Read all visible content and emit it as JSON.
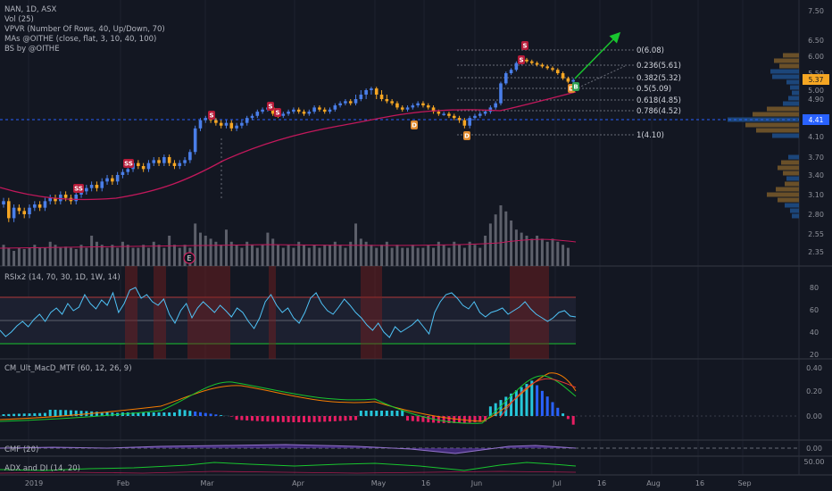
{
  "legend": {
    "title": "NAN, 1D, ASX",
    "vol": "Vol (25)",
    "vpvr": "VPVR (Number Of Rows, 40, Up/Down, 70)",
    "mas": "MAs @OITHE (close, flat, 3, 10, 40, 100)",
    "bs": "BS by @OITHE"
  },
  "panes": {
    "rsi": "RSIx2 (14, 70, 30, 1D, 1W, 14)",
    "macd": "CM_Ult_MacD_MTF (60, 12, 26, 9)",
    "cmf": "CMF (20)",
    "adx": "ADX and DI (14, 20)"
  },
  "price_axis": [
    "7.50",
    "6.50",
    "6.00",
    "5.50",
    "5.00",
    "4.90",
    "4.41",
    "4.10",
    "3.70",
    "3.40",
    "3.10",
    "2.80",
    "2.55",
    "2.35"
  ],
  "current_price": "5.37",
  "crosshair_price": "4.41",
  "rsi_axis": [
    "80",
    "60",
    "40",
    "20"
  ],
  "macd_axis": [
    "0.40",
    "0.20",
    "0.00"
  ],
  "cmf_axis": [
    "0.00"
  ],
  "adx_axis": [
    "50.00"
  ],
  "time_axis": [
    "2019",
    "Feb",
    "Mar",
    "Apr",
    "May",
    "16",
    "Jun",
    "Jul",
    "16",
    "Aug",
    "16",
    "Sep"
  ],
  "fib_levels": [
    "0(6.08)",
    "0.236(5.61)",
    "0.382(5.32)",
    "0.5(5.09)",
    "0.618(4.85)",
    "0.786(4.52)",
    "1(4.10)"
  ],
  "signals": {
    "sell": "S",
    "buy": "B",
    "double_sell": "SS",
    "divergence": "D",
    "earnings": "E"
  },
  "colors": {
    "background": "#131722",
    "up_candle": "#4a7ee8",
    "down_candle": "#f5a623",
    "ma": "#c2185b",
    "rsi": "#4fc3f7",
    "macd_up": "#26c6da",
    "macd_blue": "#2962ff",
    "macd_down": "#e91e63",
    "arrow": "#19c52f",
    "cmf": "#7e57c2",
    "adx": "#19c52f"
  },
  "chart_data": {
    "type": "candlestick",
    "ticker": "NAN",
    "interval": "1D",
    "exchange": "ASX",
    "close_series": [
      3.0,
      2.75,
      2.9,
      2.85,
      2.8,
      2.9,
      2.95,
      2.9,
      3.0,
      3.05,
      3.0,
      3.1,
      3.05,
      3.0,
      3.1,
      3.15,
      3.2,
      3.25,
      3.2,
      3.3,
      3.35,
      3.3,
      3.4,
      3.45,
      3.5,
      3.6,
      3.55,
      3.5,
      3.6,
      3.65,
      3.6,
      3.7,
      3.6,
      3.55,
      3.6,
      3.65,
      3.8,
      4.25,
      4.4,
      4.45,
      4.4,
      4.35,
      4.3,
      4.35,
      4.25,
      4.3,
      4.35,
      4.45,
      4.5,
      4.6,
      4.65,
      4.7,
      4.55,
      4.5,
      4.55,
      4.6,
      4.65,
      4.6,
      4.55,
      4.6,
      4.7,
      4.65,
      4.6,
      4.65,
      4.75,
      4.8,
      4.85,
      4.8,
      4.9,
      4.95,
      5.0,
      5.05,
      4.95,
      4.9,
      4.85,
      4.8,
      4.7,
      4.65,
      4.7,
      4.75,
      4.8,
      4.75,
      4.7,
      4.6,
      4.55,
      4.55,
      4.5,
      4.45,
      4.4,
      4.3,
      4.45,
      4.5,
      4.55,
      4.6,
      4.7,
      4.8,
      5.2,
      5.5,
      5.6,
      5.8,
      5.9,
      5.85,
      5.8,
      5.75,
      5.7,
      5.65,
      5.6,
      5.5,
      5.35,
      5.25,
      5.3
    ],
    "vol_relative": [
      0.35,
      0.3,
      0.25,
      0.3,
      0.28,
      0.3,
      0.35,
      0.3,
      0.3,
      0.4,
      0.35,
      0.3,
      0.32,
      0.3,
      0.28,
      0.35,
      0.3,
      0.5,
      0.4,
      0.35,
      0.3,
      0.35,
      0.3,
      0.4,
      0.35,
      0.3,
      0.3,
      0.35,
      0.3,
      0.4,
      0.35,
      0.3,
      0.5,
      0.35,
      0.3,
      0.35,
      0.3,
      0.7,
      0.55,
      0.5,
      0.45,
      0.4,
      0.35,
      0.6,
      0.4,
      0.35,
      0.3,
      0.4,
      0.35,
      0.3,
      0.35,
      0.55,
      0.45,
      0.35,
      0.3,
      0.35,
      0.3,
      0.4,
      0.35,
      0.3,
      0.35,
      0.3,
      0.35,
      0.35,
      0.4,
      0.35,
      0.3,
      0.4,
      0.7,
      0.45,
      0.4,
      0.35,
      0.3,
      0.35,
      0.4,
      0.3,
      0.35,
      0.3,
      0.3,
      0.35,
      0.3,
      0.3,
      0.35,
      0.3,
      0.4,
      0.35,
      0.3,
      0.4,
      0.35,
      0.3,
      0.4,
      0.35,
      0.3,
      0.5,
      0.7,
      0.85,
      1.0,
      0.9,
      0.75,
      0.6,
      0.55,
      0.5,
      0.45,
      0.5,
      0.45,
      0.4,
      0.45,
      0.4,
      0.35,
      0.3
    ]
  }
}
